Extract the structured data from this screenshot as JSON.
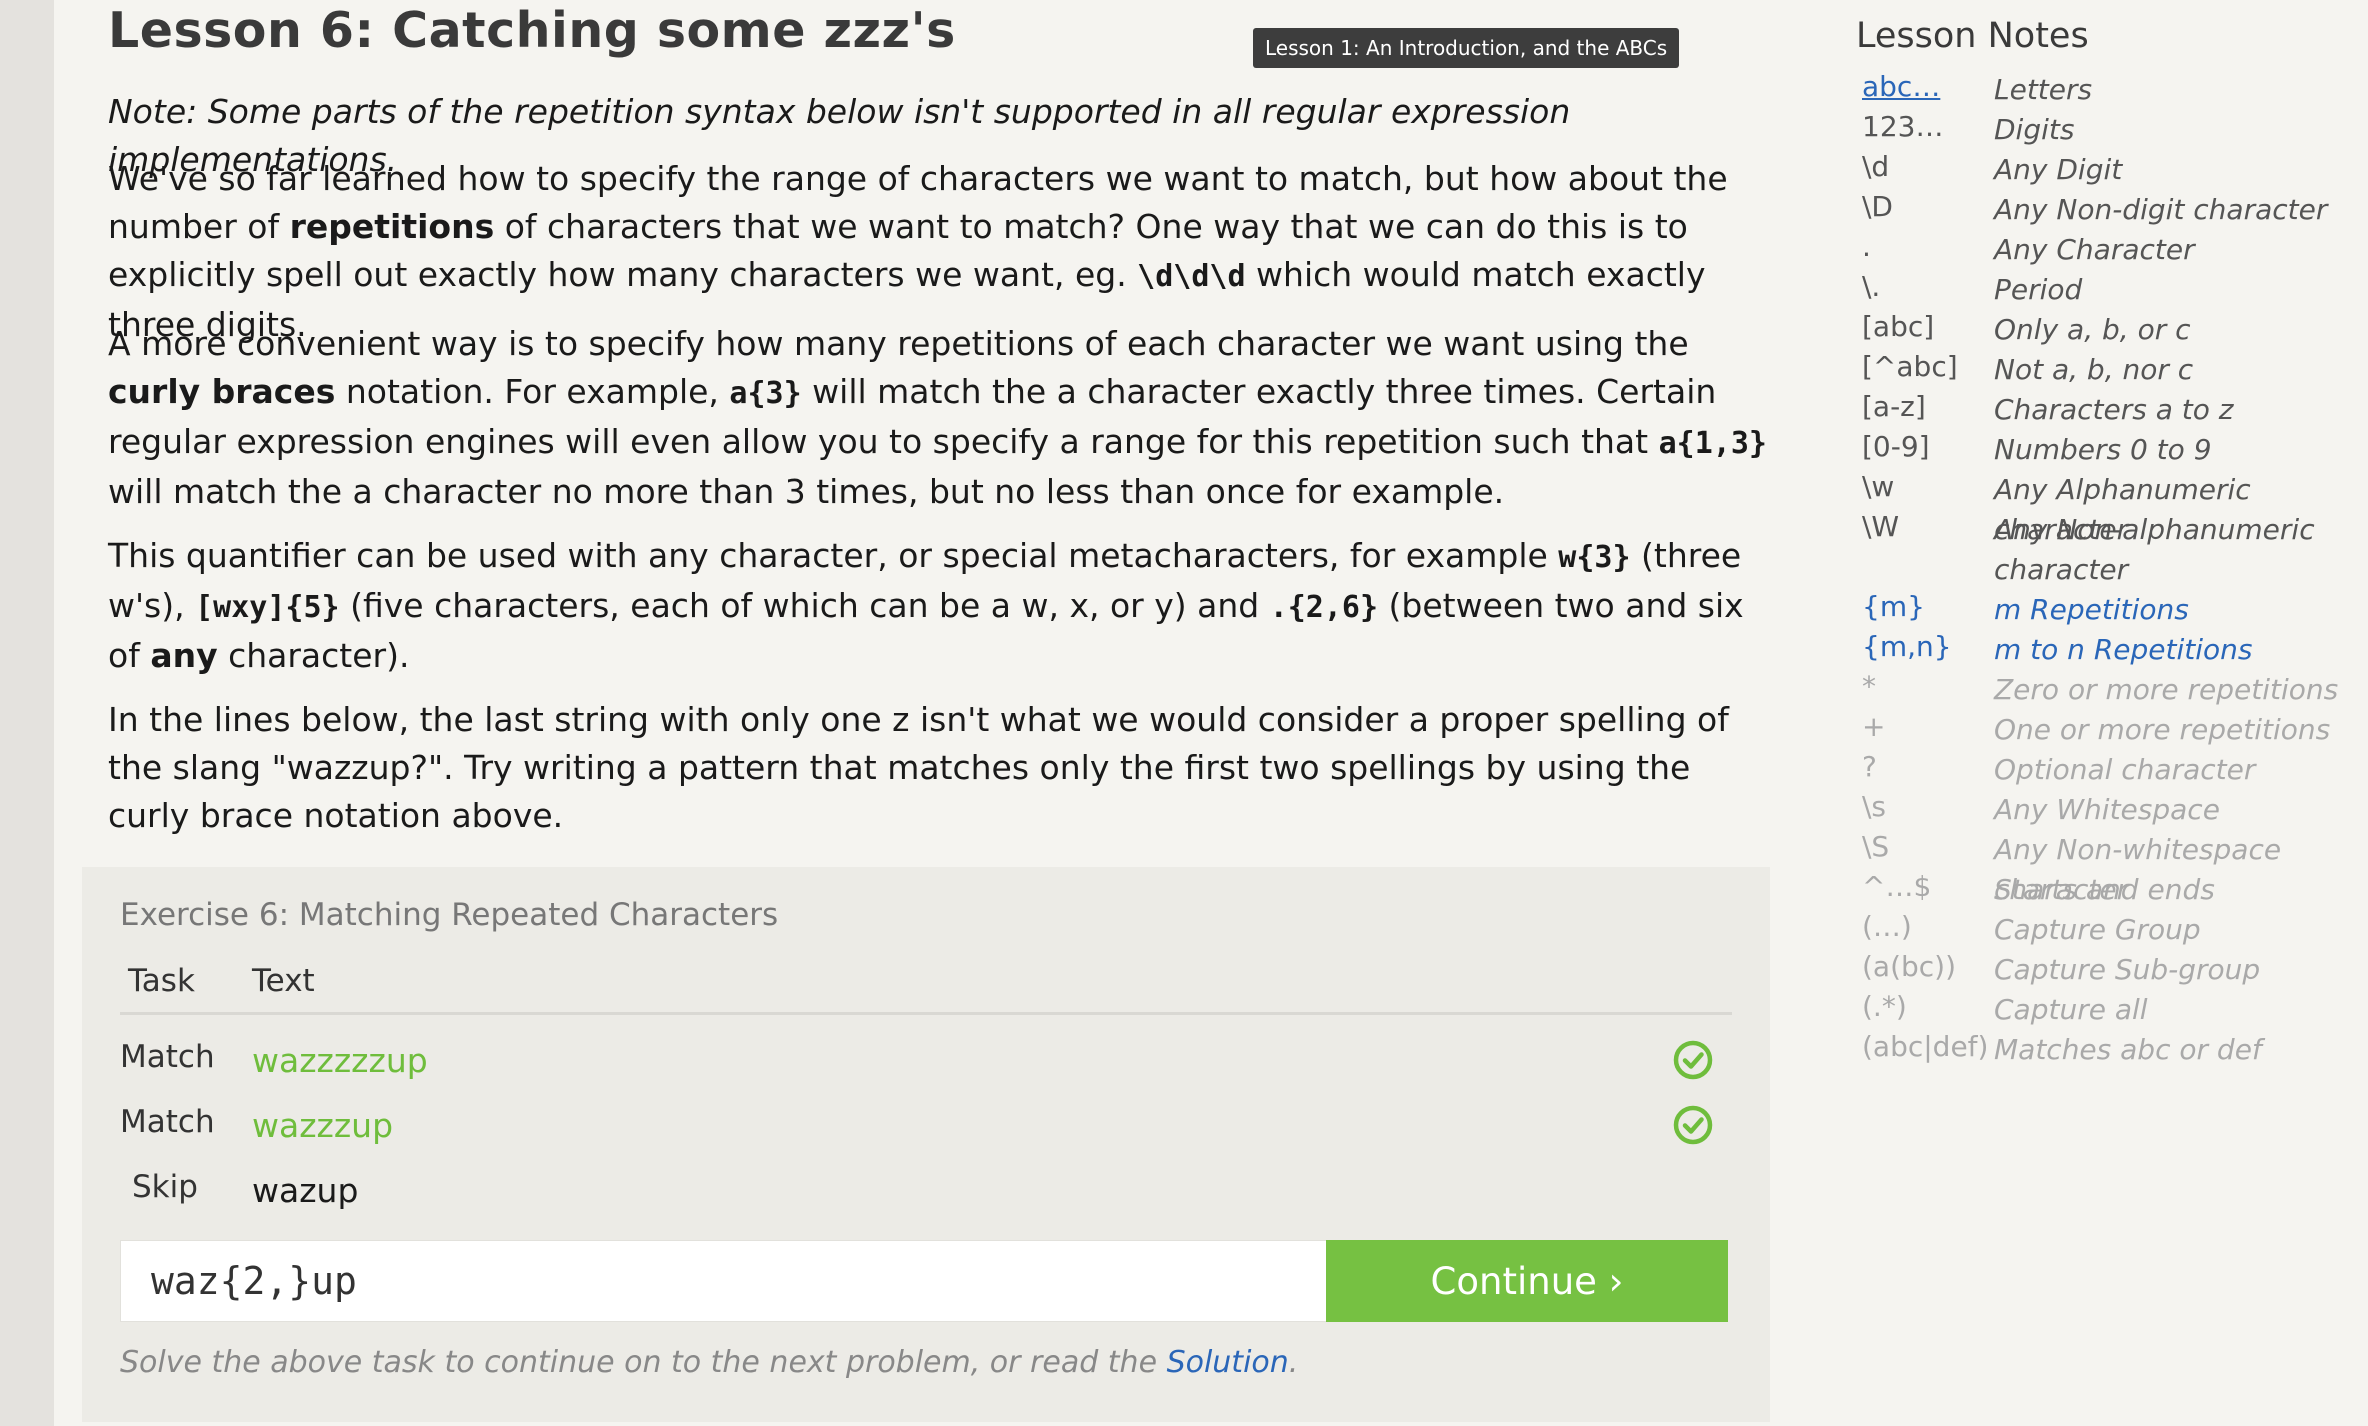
{
  "lesson": {
    "title": "Lesson 6: Catching some zzz's",
    "tooltip": "Lesson 1: An Introduction, and the ABCs",
    "note": "Note: Some parts of the repetition syntax below isn't supported in all regular expression implementations.",
    "p1": {
      "a": "We've so far learned how to specify the range of characters we want to match, but how about the number of ",
      "b": "repetitions",
      "c": " of characters that we want to match? One way that we can do this is to explicitly spell out exactly how many characters we want, eg. ",
      "d": "\\d\\d\\d",
      "e": " which would match exactly three digits."
    },
    "p2": {
      "a": "A more convenient way is to specify how many repetitions of each character we want using the ",
      "b": "curly braces",
      "c": " notation. For example, ",
      "d": "a{3}",
      "e": " will match the a character exactly three times. Certain regular expression engines will even allow you to specify a range for this repetition such that ",
      "f": "a{1,3}",
      "g": " will match the a character no more than 3 times, but no less than once for example."
    },
    "p3": {
      "a": "This quantifier can be used with any character, or special metacharacters, for example ",
      "b": "w{3}",
      "c": " (three w's), ",
      "d": "[wxy]{5}",
      "e": " (five characters, each of which can be a w, x, or y) and ",
      "f": ".{2,6}",
      "g": " (between two and six of ",
      "h": "any",
      "i": " character)."
    },
    "p4": "In the lines below, the last string with only one z isn't what we would consider a proper spelling of the slang \"wazzup?\". Try writing a pattern that matches only the first two spellings by using the curly brace notation above."
  },
  "exercise": {
    "title": "Exercise 6: Matching Repeated Characters",
    "header_task": "Task",
    "header_text": "Text",
    "rows": [
      {
        "task": "Match",
        "text": "wazzzzzup",
        "status": "matched"
      },
      {
        "task": "Match",
        "text": "wazzzup",
        "status": "matched"
      },
      {
        "task": "Skip",
        "text": "wazup",
        "status": "none"
      }
    ],
    "input_value": "waz{2,}up",
    "continue_label": "Continue ›",
    "helper_prefix": "Solve the above task to continue on to the next problem, or read the ",
    "helper_link": "Solution",
    "helper_suffix": ".",
    "colors": {
      "match_green": "#6fbd3c",
      "button_green": "#76c142",
      "link_blue": "#2a66b8"
    }
  },
  "notes": {
    "title": "Lesson Notes",
    "items": [
      {
        "sym": "abc…",
        "desc": "Letters"
      },
      {
        "sym": "123…",
        "desc": "Digits"
      },
      {
        "sym": "\\d",
        "desc": "Any Digit"
      },
      {
        "sym": "\\D",
        "desc": "Any Non-digit character"
      },
      {
        "sym": ".",
        "desc": "Any Character"
      },
      {
        "sym": "\\.",
        "desc": "Period"
      },
      {
        "sym": "[abc]",
        "desc": "Only a, b, or c"
      },
      {
        "sym": "[^abc]",
        "desc": "Not a, b, nor c"
      },
      {
        "sym": "[a-z]",
        "desc": "Characters a to z"
      },
      {
        "sym": "[0-9]",
        "desc": "Numbers 0 to 9"
      },
      {
        "sym": "\\w",
        "desc": "Any Alphanumeric character"
      },
      {
        "sym": "\\W",
        "desc": "Any Non-alphanumeric character"
      },
      {
        "sym": "{m}",
        "desc": "m Repetitions"
      },
      {
        "sym": "{m,n}",
        "desc": "m to n Repetitions"
      },
      {
        "sym": "*",
        "desc": "Zero or more repetitions"
      },
      {
        "sym": "+",
        "desc": "One or more repetitions"
      },
      {
        "sym": "?",
        "desc": "Optional character"
      },
      {
        "sym": "\\s",
        "desc": "Any Whitespace"
      },
      {
        "sym": "\\S",
        "desc": "Any Non-whitespace character"
      },
      {
        "sym": "^…$",
        "desc": "Starts and ends"
      },
      {
        "sym": "(…)",
        "desc": "Capture Group"
      },
      {
        "sym": "(a(bc))",
        "desc": "Capture Sub-group"
      },
      {
        "sym": "(.*)",
        "desc": "Capture all"
      },
      {
        "sym": "(abc|def)",
        "desc": "Matches abc or def"
      }
    ]
  }
}
